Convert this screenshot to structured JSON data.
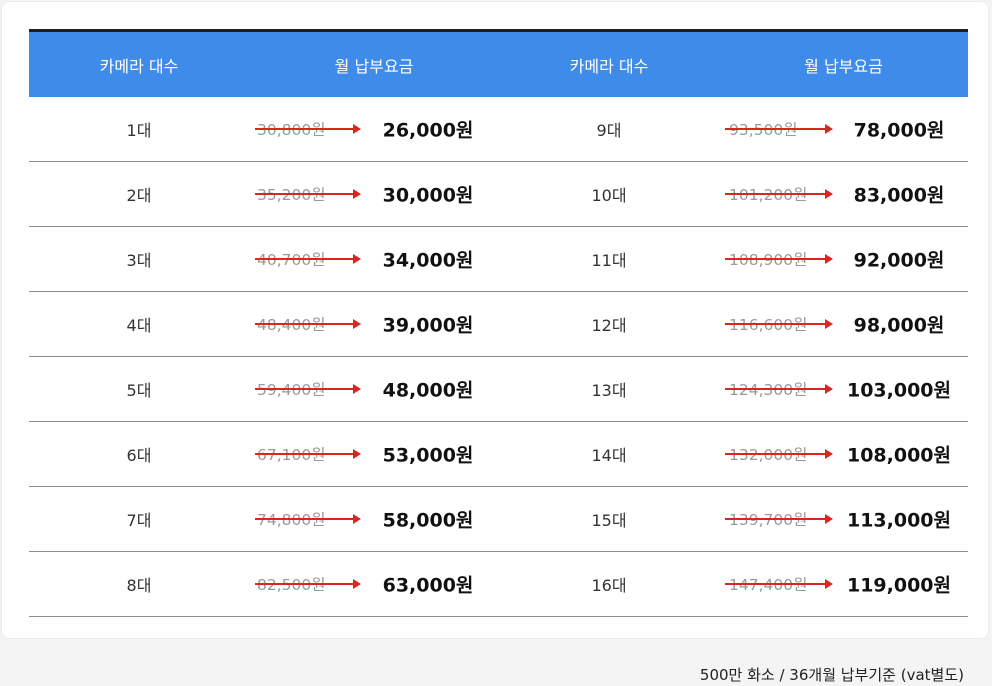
{
  "header": {
    "col1": "카메라 대수",
    "col2": "월 납부요금",
    "col3": "카메라 대수",
    "col4": "월 납부요금"
  },
  "rows": [
    {
      "left": {
        "count": "1대",
        "old": "30,800원",
        "new": "26,000원"
      },
      "right": {
        "count": "9대",
        "old": "93,500원",
        "new": "78,000원"
      }
    },
    {
      "left": {
        "count": "2대",
        "old": "35,200원",
        "new": "30,000원"
      },
      "right": {
        "count": "10대",
        "old": "101,200원",
        "new": "83,000원"
      }
    },
    {
      "left": {
        "count": "3대",
        "old": "40,700원",
        "new": "34,000원"
      },
      "right": {
        "count": "11대",
        "old": "108,900원",
        "new": "92,000원"
      }
    },
    {
      "left": {
        "count": "4대",
        "old": "48,400원",
        "new": "39,000원"
      },
      "right": {
        "count": "12대",
        "old": "116,600원",
        "new": "98,000원"
      }
    },
    {
      "left": {
        "count": "5대",
        "old": "59,400원",
        "new": "48,000원"
      },
      "right": {
        "count": "13대",
        "old": "124,300원",
        "new": "103,000원"
      }
    },
    {
      "left": {
        "count": "6대",
        "old": "67,100원",
        "new": "53,000원"
      },
      "right": {
        "count": "14대",
        "old": "132,000원",
        "new": "108,000원"
      }
    },
    {
      "left": {
        "count": "7대",
        "old": "74,800원",
        "new": "58,000원"
      },
      "right": {
        "count": "15대",
        "old": "139,700원",
        "new": "113,000원"
      }
    },
    {
      "left": {
        "count": "8대",
        "old": "82,500원",
        "new": "63,000원"
      },
      "right": {
        "count": "16대",
        "old": "147,400원",
        "new": "119,000원"
      }
    }
  ],
  "footnote": "500만 화소 / 36개월 납부기준 (vat별도)",
  "colors": {
    "header_bg": "#3f8be9",
    "strike_arrow": "#d8271f"
  }
}
